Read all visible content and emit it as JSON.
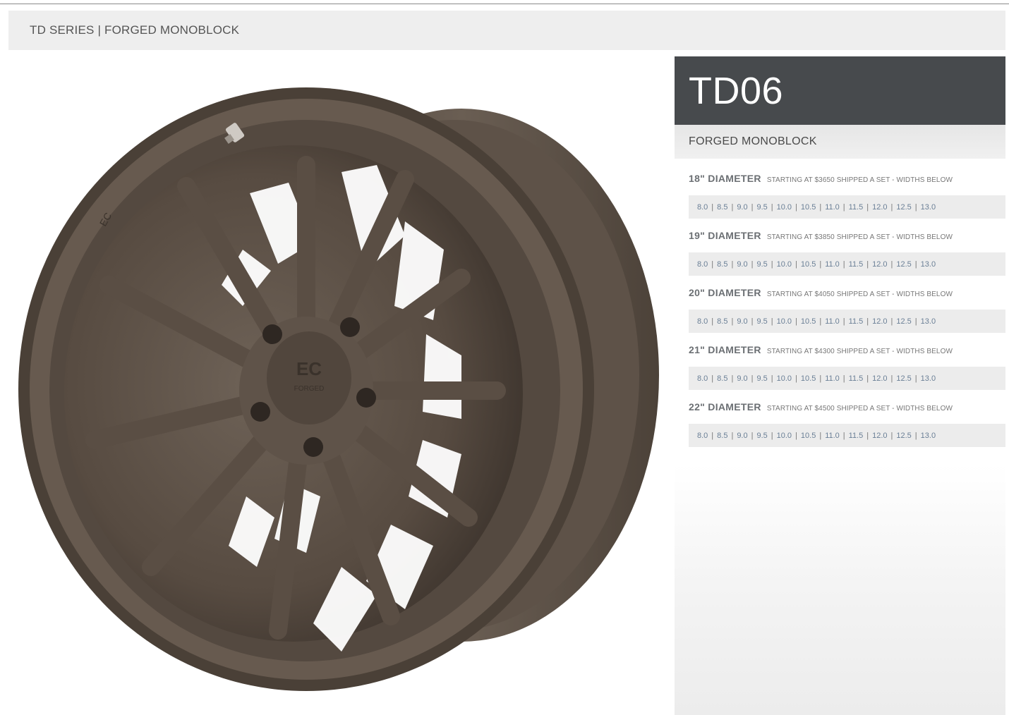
{
  "header": {
    "breadcrumb": "TD SERIES | FORGED MONOBLOCK"
  },
  "product": {
    "model": "TD06",
    "construction": "FORGED MONOBLOCK",
    "image_alt": "wheel-image",
    "wheel_color": "#5c5046",
    "rim_badge": "EC",
    "cap_logo_top": "EC",
    "cap_logo_bottom": "FORGED"
  },
  "sizes": [
    {
      "diameter": "18\" DIAMETER",
      "note": "STARTING AT $3650 SHIPPED A SET - WIDTHS BELOW",
      "widths": [
        "8.0",
        "8.5",
        "9.0",
        "9.5",
        "10.0",
        "10.5",
        "11.0",
        "11.5",
        "12.0",
        "12.5",
        "13.0"
      ]
    },
    {
      "diameter": "19\" DIAMETER",
      "note": "STARTING AT $3850 SHIPPED A SET - WIDTHS BELOW",
      "widths": [
        "8.0",
        "8.5",
        "9.0",
        "9.5",
        "10.0",
        "10.5",
        "11.0",
        "11.5",
        "12.0",
        "12.5",
        "13.0"
      ]
    },
    {
      "diameter": "20\" DIAMETER",
      "note": "STARTING AT $4050 SHIPPED A SET - WIDTHS BELOW",
      "widths": [
        "8.0",
        "8.5",
        "9.0",
        "9.5",
        "10.0",
        "10.5",
        "11.0",
        "11.5",
        "12.0",
        "12.5",
        "13.0"
      ]
    },
    {
      "diameter": "21\" DIAMETER",
      "note": "STARTING AT $4300 SHIPPED A SET - WIDTHS BELOW",
      "widths": [
        "8.0",
        "8.5",
        "9.0",
        "9.5",
        "10.0",
        "10.5",
        "11.0",
        "11.5",
        "12.0",
        "12.5",
        "13.0"
      ]
    },
    {
      "diameter": "22\" DIAMETER",
      "note": "STARTING AT $4500 SHIPPED A SET - WIDTHS BELOW",
      "widths": [
        "8.0",
        "8.5",
        "9.0",
        "9.5",
        "10.0",
        "10.5",
        "11.0",
        "11.5",
        "12.0",
        "12.5",
        "13.0"
      ]
    }
  ]
}
